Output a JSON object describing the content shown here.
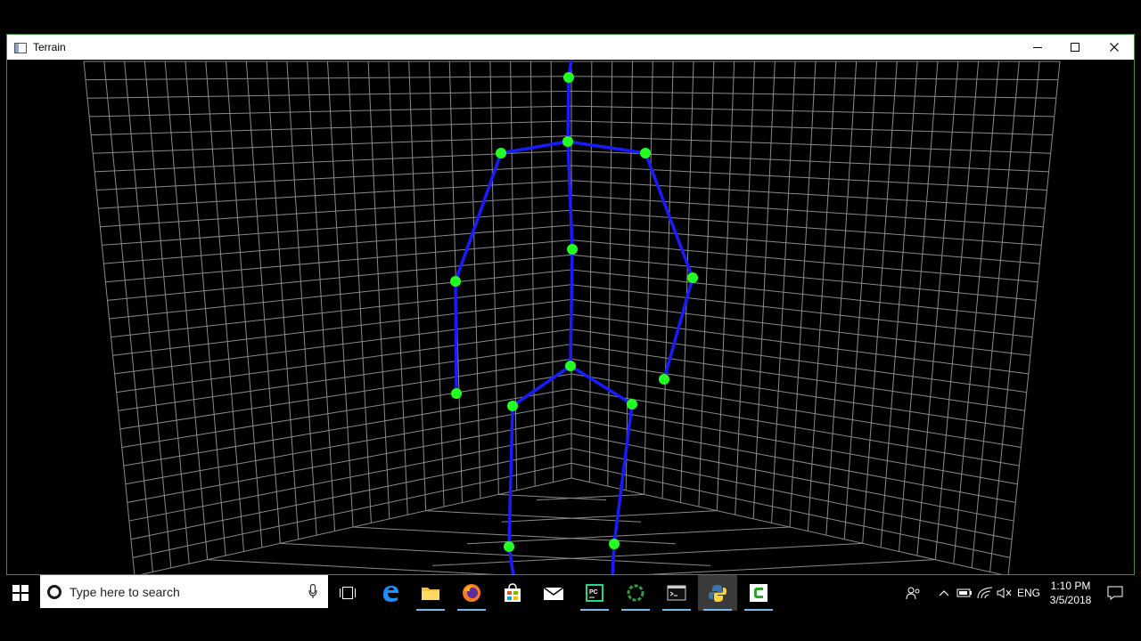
{
  "window": {
    "title": "Terrain",
    "controls": {
      "minimize": "minimize-icon",
      "maximize": "maximize-icon",
      "close": "close-icon"
    }
  },
  "scene": {
    "grid_color": "#8a8a8a",
    "bone_color": "#1a1aff",
    "joint_color": "#22ff22",
    "background": "#000000"
  },
  "taskbar": {
    "search_placeholder": "Type here to search",
    "apps": [
      {
        "name": "task-view",
        "icon": "task-view-icon"
      },
      {
        "name": "edge",
        "icon": "edge-icon"
      },
      {
        "name": "file-explorer",
        "icon": "folder-icon"
      },
      {
        "name": "firefox",
        "icon": "firefox-icon"
      },
      {
        "name": "store",
        "icon": "store-icon"
      },
      {
        "name": "mail",
        "icon": "mail-icon"
      },
      {
        "name": "pycharm",
        "icon": "pycharm-icon"
      },
      {
        "name": "loading-app",
        "icon": "ring-icon"
      },
      {
        "name": "terminal",
        "icon": "terminal-icon"
      },
      {
        "name": "python",
        "icon": "python-icon"
      },
      {
        "name": "camtasia",
        "icon": "camtasia-icon"
      }
    ],
    "tray": {
      "language": "ENG",
      "time": "1:10 PM",
      "date": "3/5/2018"
    }
  }
}
